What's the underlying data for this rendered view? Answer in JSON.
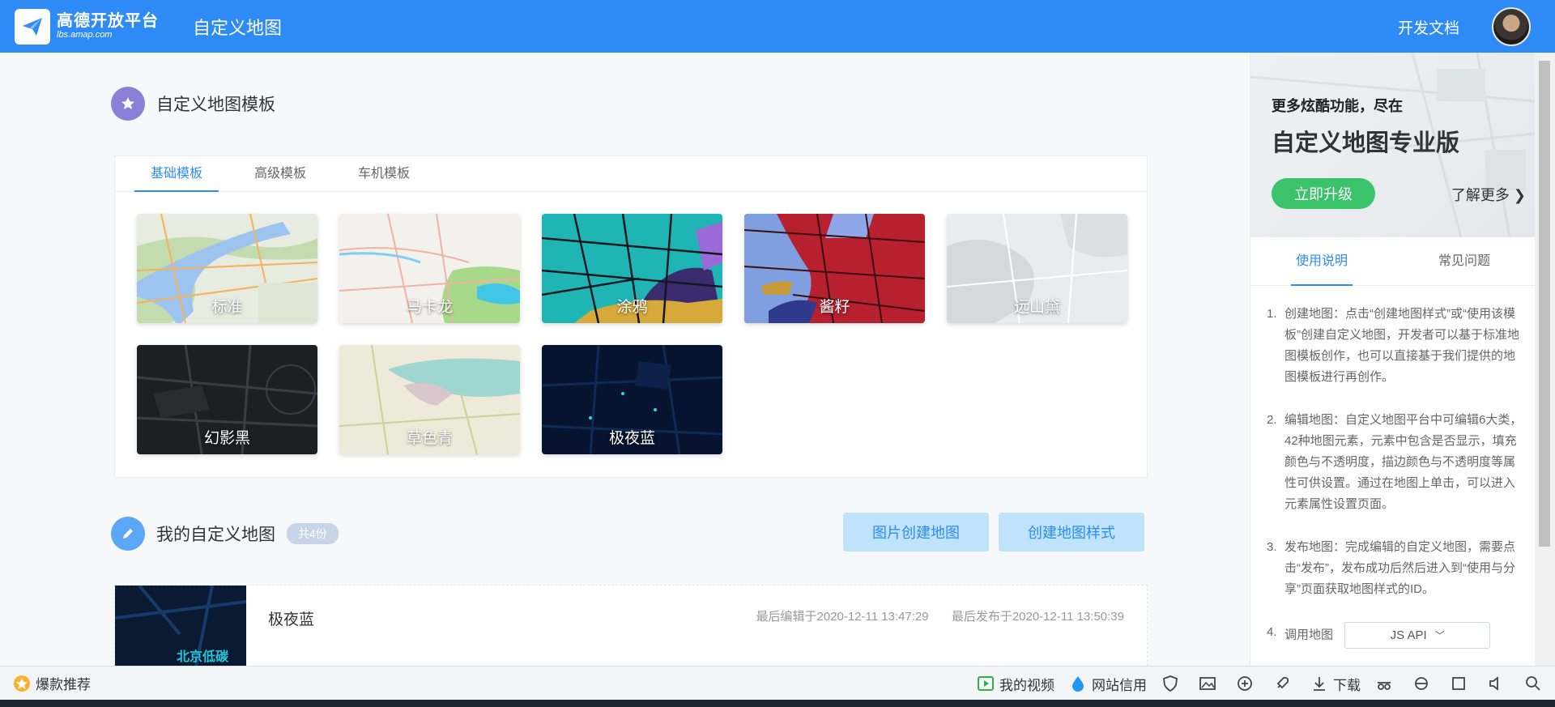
{
  "header": {
    "logo_title": "高德开放平台",
    "logo_sub": "lbs.amap.com",
    "page_title": "自定义地图",
    "doc_link": "开发文档"
  },
  "templates_section": {
    "title": "自定义地图模板",
    "tabs": [
      "基础模板",
      "高级模板",
      "车机模板"
    ],
    "active_tab": "基础模板",
    "items": [
      {
        "label": "标准"
      },
      {
        "label": "马卡龙"
      },
      {
        "label": "涂鸦"
      },
      {
        "label": "酱籽"
      },
      {
        "label": "远山黛"
      },
      {
        "label": "幻影黑"
      },
      {
        "label": "草色青"
      },
      {
        "label": "极夜蓝"
      }
    ]
  },
  "my_maps": {
    "title": "我的自定义地图",
    "count_badge": "共4份",
    "btn_image_create": "图片创建地图",
    "btn_style_create": "创建地图样式",
    "list": [
      {
        "name": "极夜蓝",
        "thumb_text": "北京低碳",
        "last_edit": "最后编辑于2020-12-11 13:47:29",
        "last_publish": "最后发布于2020-12-11 13:50:39"
      }
    ]
  },
  "sidebar": {
    "promo_small": "更多炫酷功能，尽在",
    "promo_big": "自定义地图专业版",
    "promo_btn": "立即升级",
    "promo_more": "了解更多",
    "tabs": [
      "使用说明",
      "常见问题"
    ],
    "active_tab": "使用说明",
    "instructions": [
      {
        "num": "1.",
        "text": "创建地图：点击“创建地图样式”或“使用该模板”创建自定义地图，开发者可以基于标准地图模板创作，也可以直接基于我们提供的地图模板进行再创作。"
      },
      {
        "num": "2.",
        "text": "编辑地图：自定义地图平台中可编辑6大类，42种地图元素，元素中包含是否显示，填充颜色与不透明度，描边颜色与不透明度等属性可供设置。通过在地图上单击，可以进入元素属性设置页面。"
      },
      {
        "num": "3.",
        "text": "发布地图：完成编辑的自定义地图，需要点击“发布”，发布成功后然后进入到“使用与分享”页面获取地图样式的ID。"
      },
      {
        "num": "4.",
        "text": "调用地图"
      }
    ],
    "api_select": "JS API"
  },
  "bottom_bar": {
    "left_label": "爆款推荐",
    "video": "我的视频",
    "credit": "网站信用",
    "download": "下载"
  },
  "colors": {
    "header_bg": "#2e8bf5",
    "accent": "#2e8bf5",
    "upgrade_green": "#3ac36a",
    "light_btn": "#bfe3fb"
  }
}
